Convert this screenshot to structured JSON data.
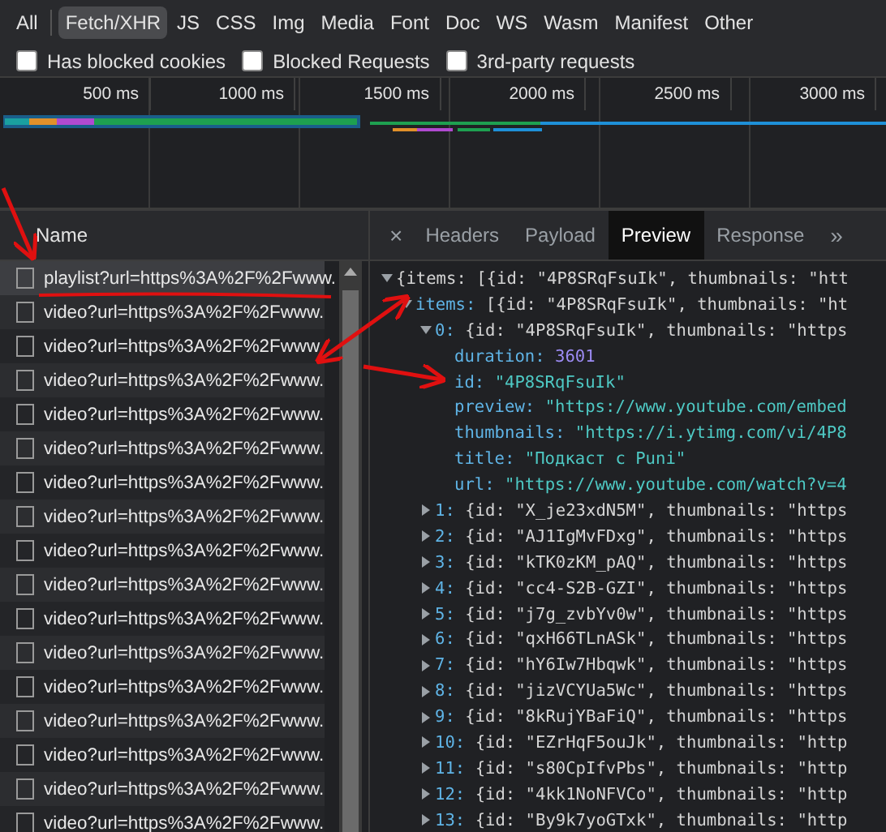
{
  "filters": [
    {
      "label": "All",
      "selected": false
    },
    {
      "label": "Fetch/XHR",
      "selected": true
    },
    {
      "label": "JS",
      "selected": false
    },
    {
      "label": "CSS",
      "selected": false
    },
    {
      "label": "Img",
      "selected": false
    },
    {
      "label": "Media",
      "selected": false
    },
    {
      "label": "Font",
      "selected": false
    },
    {
      "label": "Doc",
      "selected": false
    },
    {
      "label": "WS",
      "selected": false
    },
    {
      "label": "Wasm",
      "selected": false
    },
    {
      "label": "Manifest",
      "selected": false
    },
    {
      "label": "Other",
      "selected": false
    }
  ],
  "options": [
    {
      "label": "Has blocked cookies",
      "checked": false
    },
    {
      "label": "Blocked Requests",
      "checked": false
    },
    {
      "label": "3rd-party requests",
      "checked": false
    }
  ],
  "timeline": {
    "ticks": [
      "500 ms",
      "1000 ms",
      "1500 ms",
      "2000 ms",
      "2500 ms",
      "3000 ms"
    ]
  },
  "requests": {
    "column": "Name",
    "rows": [
      {
        "name": "playlist?url=https%3A%2F%2Fwww.",
        "selected": true
      },
      {
        "name": "video?url=https%3A%2F%2Fwww.",
        "selected": false
      },
      {
        "name": "video?url=https%3A%2F%2Fwww.",
        "selected": false
      },
      {
        "name": "video?url=https%3A%2F%2Fwww.",
        "selected": false
      },
      {
        "name": "video?url=https%3A%2F%2Fwww.",
        "selected": false
      },
      {
        "name": "video?url=https%3A%2F%2Fwww.",
        "selected": false
      },
      {
        "name": "video?url=https%3A%2F%2Fwww.",
        "selected": false
      },
      {
        "name": "video?url=https%3A%2F%2Fwww.",
        "selected": false
      },
      {
        "name": "video?url=https%3A%2F%2Fwww.",
        "selected": false
      },
      {
        "name": "video?url=https%3A%2F%2Fwww.",
        "selected": false
      },
      {
        "name": "video?url=https%3A%2F%2Fwww.",
        "selected": false
      },
      {
        "name": "video?url=https%3A%2F%2Fwww.",
        "selected": false
      },
      {
        "name": "video?url=https%3A%2F%2Fwww.",
        "selected": false
      },
      {
        "name": "video?url=https%3A%2F%2Fwww.",
        "selected": false
      },
      {
        "name": "video?url=https%3A%2F%2Fwww.",
        "selected": false
      },
      {
        "name": "video?url=https%3A%2F%2Fwww.",
        "selected": false
      },
      {
        "name": "video?url=https%3A%2F%2Fwww.",
        "selected": false
      }
    ]
  },
  "details": {
    "close": "×",
    "tabs": [
      {
        "label": "Headers",
        "selected": false
      },
      {
        "label": "Payload",
        "selected": false
      },
      {
        "label": "Preview",
        "selected": true
      },
      {
        "label": "Response",
        "selected": false
      }
    ],
    "more": "»",
    "preview": {
      "kind": "object",
      "value": "{items: [{id: \"4P8SRqFsuIk\", thumbnails: \"htt",
      "expanded": true,
      "children": [
        {
          "key": "items:",
          "kind": "object",
          "value": "[{id: \"4P8SRqFsuIk\", thumbnails: \"ht",
          "expanded": true,
          "children": [
            {
              "key": "0:",
              "kind": "object",
              "value": "{id: \"4P8SRqFsuIk\", thumbnails: \"https",
              "expanded": true,
              "children": [
                {
                  "key": "duration:",
                  "kind": "number",
                  "value": "3601"
                },
                {
                  "key": "id:",
                  "kind": "string",
                  "value": "\"4P8SRqFsuIk\""
                },
                {
                  "key": "preview:",
                  "kind": "string",
                  "value": "\"https://www.youtube.com/embed"
                },
                {
                  "key": "thumbnails:",
                  "kind": "string",
                  "value": "\"https://i.ytimg.com/vi/4P8"
                },
                {
                  "key": "title:",
                  "kind": "string",
                  "value": "\"Подкаст с Puni\""
                },
                {
                  "key": "url:",
                  "kind": "string",
                  "value": "\"https://www.youtube.com/watch?v=4"
                }
              ]
            },
            {
              "key": "1:",
              "kind": "object",
              "value": "{id: \"X_je23xdN5M\", thumbnails: \"https",
              "expanded": false
            },
            {
              "key": "2:",
              "kind": "object",
              "value": "{id: \"AJ1IgMvFDxg\", thumbnails: \"https",
              "expanded": false
            },
            {
              "key": "3:",
              "kind": "object",
              "value": "{id: \"kTK0zKM_pAQ\", thumbnails: \"https",
              "expanded": false
            },
            {
              "key": "4:",
              "kind": "object",
              "value": "{id: \"cc4-S2B-GZI\", thumbnails: \"https",
              "expanded": false
            },
            {
              "key": "5:",
              "kind": "object",
              "value": "{id: \"j7g_zvbYv0w\", thumbnails: \"https",
              "expanded": false
            },
            {
              "key": "6:",
              "kind": "object",
              "value": "{id: \"qxH66TLnASk\", thumbnails: \"https",
              "expanded": false
            },
            {
              "key": "7:",
              "kind": "object",
              "value": "{id: \"hY6Iw7Hbqwk\", thumbnails: \"https",
              "expanded": false
            },
            {
              "key": "8:",
              "kind": "object",
              "value": "{id: \"jizVCYUa5Wc\", thumbnails: \"https",
              "expanded": false
            },
            {
              "key": "9:",
              "kind": "object",
              "value": "{id: \"8kRujYBaFiQ\", thumbnails: \"https",
              "expanded": false
            },
            {
              "key": "10:",
              "kind": "object",
              "value": "{id: \"EZrHqF5ouJk\", thumbnails: \"http",
              "expanded": false
            },
            {
              "key": "11:",
              "kind": "object",
              "value": "{id: \"s80CpIfvPbs\", thumbnails: \"http",
              "expanded": false
            },
            {
              "key": "12:",
              "kind": "object",
              "value": "{id: \"4kk1NoNFVCo\", thumbnails: \"http",
              "expanded": false
            },
            {
              "key": "13:",
              "kind": "object",
              "value": "{id: \"By9k7yoGTxk\", thumbnails: \"http",
              "expanded": false
            }
          ]
        }
      ]
    }
  }
}
